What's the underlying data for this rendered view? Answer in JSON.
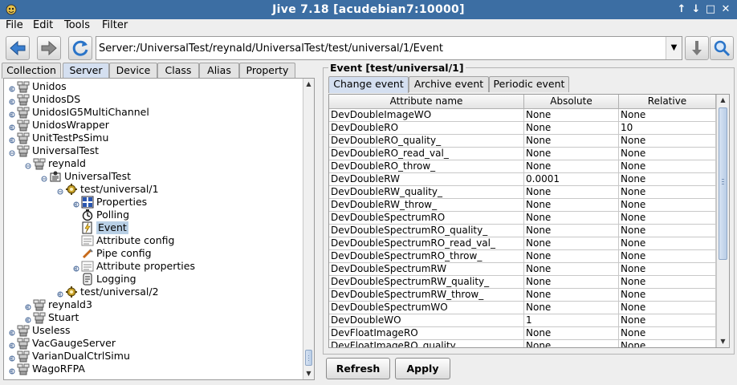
{
  "window": {
    "title": "Jive 7.18 [acudebian7:10000]",
    "controls": [
      "↑",
      "↓",
      "□",
      "✕"
    ]
  },
  "menubar": [
    "File",
    "Edit",
    "Tools",
    "Filter"
  ],
  "toolbar": {
    "address": "Server:/UniversalTest/reynald/UniversalTest/test/universal/1/Event",
    "dropdown_glyph": "▼"
  },
  "left_tabs": [
    "Collection",
    "Server",
    "Device",
    "Class",
    "Alias",
    "Property"
  ],
  "left_active_tab": "Server",
  "tree": [
    {
      "label": "Unidos",
      "icon": "server-icon",
      "depth": 0,
      "state": "collapsed"
    },
    {
      "label": "UnidosDS",
      "icon": "server-icon",
      "depth": 0,
      "state": "collapsed"
    },
    {
      "label": "UnidosIG5MultiChannel",
      "icon": "server-icon",
      "depth": 0,
      "state": "collapsed"
    },
    {
      "label": "UnidosWrapper",
      "icon": "server-icon",
      "depth": 0,
      "state": "collapsed"
    },
    {
      "label": "UnitTestPsSimu",
      "icon": "server-icon",
      "depth": 0,
      "state": "collapsed"
    },
    {
      "label": "UniversalTest",
      "icon": "server-icon",
      "depth": 0,
      "state": "expanded"
    },
    {
      "label": "reynald",
      "icon": "server-instance-icon",
      "depth": 1,
      "state": "expanded"
    },
    {
      "label": "UniversalTest",
      "icon": "class-icon",
      "depth": 2,
      "state": "expanded"
    },
    {
      "label": "test/universal/1",
      "icon": "device-icon",
      "depth": 3,
      "state": "expanded"
    },
    {
      "label": "Properties",
      "icon": "properties-icon",
      "depth": 4,
      "state": "collapsed"
    },
    {
      "label": "Polling",
      "icon": "polling-icon",
      "depth": 4,
      "state": "leaf"
    },
    {
      "label": "Event",
      "icon": "event-icon",
      "depth": 4,
      "state": "leaf",
      "selected": true
    },
    {
      "label": "Attribute config",
      "icon": "attribute-config-icon",
      "depth": 4,
      "state": "leaf"
    },
    {
      "label": "Pipe config",
      "icon": "pipe-config-icon",
      "depth": 4,
      "state": "leaf"
    },
    {
      "label": "Attribute properties",
      "icon": "attribute-properties-icon",
      "depth": 4,
      "state": "collapsed"
    },
    {
      "label": "Logging",
      "icon": "logging-icon",
      "depth": 4,
      "state": "leaf"
    },
    {
      "label": "test/universal/2",
      "icon": "device-icon",
      "depth": 3,
      "state": "collapsed"
    },
    {
      "label": "reynald3",
      "icon": "server-instance-icon",
      "depth": 1,
      "state": "collapsed"
    },
    {
      "label": "Stuart",
      "icon": "server-instance-icon",
      "depth": 1,
      "state": "collapsed"
    },
    {
      "label": "Useless",
      "icon": "server-icon",
      "depth": 0,
      "state": "collapsed"
    },
    {
      "label": "VacGaugeServer",
      "icon": "server-icon",
      "depth": 0,
      "state": "collapsed"
    },
    {
      "label": "VarianDualCtrlSimu",
      "icon": "server-icon",
      "depth": 0,
      "state": "collapsed"
    },
    {
      "label": "WagoRFPA",
      "icon": "server-icon",
      "depth": 0,
      "state": "collapsed"
    }
  ],
  "event_panel": {
    "title": "Event [test/universal/1]",
    "tabs": [
      "Change event",
      "Archive event",
      "Periodic event"
    ],
    "active_tab": "Change event",
    "columns": [
      "Attribute name",
      "Absolute",
      "Relative"
    ],
    "rows": [
      [
        "DevDoubleImageWO",
        "None",
        "None"
      ],
      [
        "DevDoubleRO",
        "None",
        "10"
      ],
      [
        "DevDoubleRO_quality_",
        "None",
        "None"
      ],
      [
        "DevDoubleRO_read_val_",
        "None",
        "None"
      ],
      [
        "DevDoubleRO_throw_",
        "None",
        "None"
      ],
      [
        "DevDoubleRW",
        "0.0001",
        "None"
      ],
      [
        "DevDoubleRW_quality_",
        "None",
        "None"
      ],
      [
        "DevDoubleRW_throw_",
        "None",
        "None"
      ],
      [
        "DevDoubleSpectrumRO",
        "None",
        "None"
      ],
      [
        "DevDoubleSpectrumRO_quality_",
        "None",
        "None"
      ],
      [
        "DevDoubleSpectrumRO_read_val_",
        "None",
        "None"
      ],
      [
        "DevDoubleSpectrumRO_throw_",
        "None",
        "None"
      ],
      [
        "DevDoubleSpectrumRW",
        "None",
        "None"
      ],
      [
        "DevDoubleSpectrumRW_quality_",
        "None",
        "None"
      ],
      [
        "DevDoubleSpectrumRW_throw_",
        "None",
        "None"
      ],
      [
        "DevDoubleSpectrumWO",
        "None",
        "None"
      ],
      [
        "DevDoubleWO",
        "1",
        "None"
      ],
      [
        "DevFloatImageRO",
        "None",
        "None"
      ],
      [
        "DevFloatImageRO_quality_",
        "None",
        "None"
      ]
    ],
    "buttons": {
      "refresh": "Refresh",
      "apply": "Apply"
    }
  }
}
